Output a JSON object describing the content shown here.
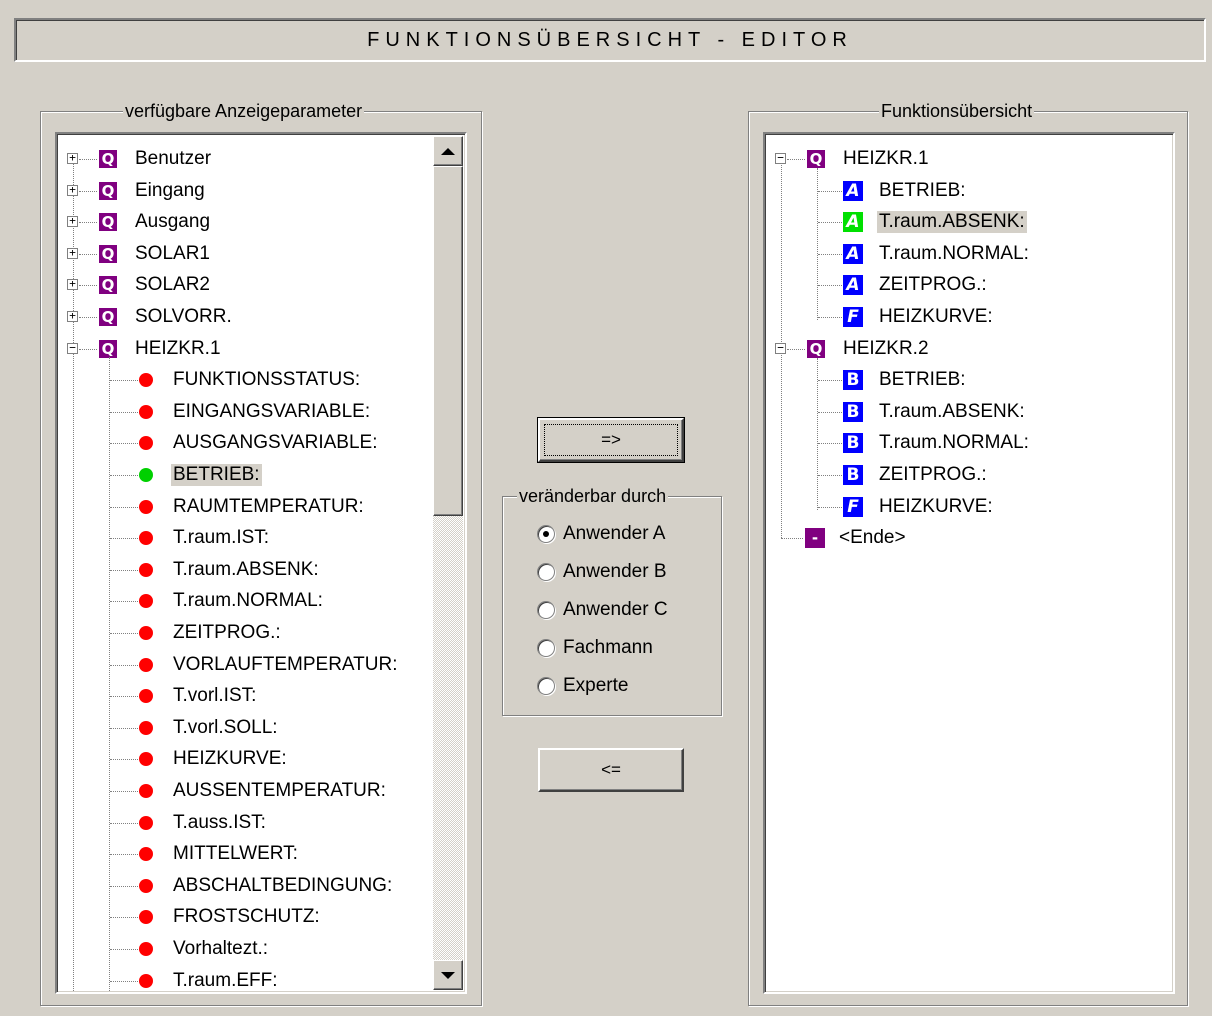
{
  "title": "FUNKTIONSÜBERSICHT - EDITOR",
  "left_panel": {
    "title": "verfügbare Anzeigeparameter",
    "groups": [
      {
        "label": "Benutzer",
        "expanded": false
      },
      {
        "label": "Eingang",
        "expanded": false
      },
      {
        "label": "Ausgang",
        "expanded": false
      },
      {
        "label": "SOLAR1",
        "expanded": false
      },
      {
        "label": "SOLAR2",
        "expanded": false
      },
      {
        "label": "SOLVORR.",
        "expanded": false
      },
      {
        "label": "HEIZKR.1",
        "expanded": true
      }
    ],
    "group_icon": "Q",
    "expand_glyph": "+",
    "collapse_glyph": "−",
    "children": [
      {
        "label": "FUNKTIONSSTATUS:",
        "status": "red"
      },
      {
        "label": "EINGANGSVARIABLE:",
        "status": "red"
      },
      {
        "label": "AUSGANGSVARIABLE:",
        "status": "red"
      },
      {
        "label": "BETRIEB:",
        "status": "green",
        "selected": true
      },
      {
        "label": "RAUMTEMPERATUR:",
        "status": "red"
      },
      {
        "label": "T.raum.IST:",
        "status": "red"
      },
      {
        "label": "T.raum.ABSENK:",
        "status": "red"
      },
      {
        "label": "T.raum.NORMAL:",
        "status": "red"
      },
      {
        "label": "ZEITPROG.:",
        "status": "red"
      },
      {
        "label": "VORLAUFTEMPERATUR:",
        "status": "red"
      },
      {
        "label": "T.vorl.IST:",
        "status": "red"
      },
      {
        "label": "T.vorl.SOLL:",
        "status": "red"
      },
      {
        "label": "HEIZKURVE:",
        "status": "red"
      },
      {
        "label": "AUSSENTEMPERATUR:",
        "status": "red"
      },
      {
        "label": "T.auss.IST:",
        "status": "red"
      },
      {
        "label": "MITTELWERT:",
        "status": "red"
      },
      {
        "label": "ABSCHALTBEDINGUNG:",
        "status": "red"
      },
      {
        "label": "FROSTSCHUTZ:",
        "status": "red"
      },
      {
        "label": "Vorhaltezt.:",
        "status": "red"
      },
      {
        "label": "T.raum.EFF:",
        "status": "red"
      }
    ],
    "colors": {
      "red": "#ff0000",
      "green": "#00d000",
      "group_icon_bg": "#800080"
    }
  },
  "middle": {
    "add_button_label": "=>",
    "remove_button_label": "<=",
    "radio_group_title": "veränderbar durch",
    "radio_options": [
      "Anwender A",
      "Anwender B",
      "Anwender C",
      "Fachmann",
      "Experte"
    ],
    "radio_selected": "Anwender A"
  },
  "right_panel": {
    "title": "Funktionsübersicht",
    "groups": [
      {
        "label": "HEIZKR.1",
        "children": [
          {
            "label": "BETRIEB:",
            "icon": "A",
            "color": "blue"
          },
          {
            "label": "T.raum.ABSENK:",
            "icon": "A",
            "color": "green",
            "selected": true
          },
          {
            "label": "T.raum.NORMAL:",
            "icon": "A",
            "color": "blue"
          },
          {
            "label": "ZEITPROG.:",
            "icon": "A",
            "color": "blue"
          },
          {
            "label": "HEIZKURVE:",
            "icon": "F",
            "color": "blue"
          }
        ]
      },
      {
        "label": "HEIZKR.2",
        "children": [
          {
            "label": "BETRIEB:",
            "icon": "B",
            "color": "blue"
          },
          {
            "label": "T.raum.ABSENK:",
            "icon": "B",
            "color": "blue"
          },
          {
            "label": "T.raum.NORMAL:",
            "icon": "B",
            "color": "blue"
          },
          {
            "label": "ZEITPROG.:",
            "icon": "B",
            "color": "blue"
          },
          {
            "label": "HEIZKURVE:",
            "icon": "F",
            "color": "blue"
          }
        ]
      }
    ],
    "end_label": "<Ende>",
    "end_icon": "-"
  }
}
